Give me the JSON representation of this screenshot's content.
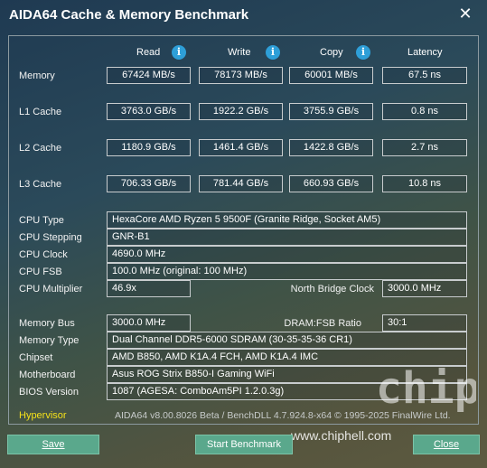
{
  "window": {
    "title": "AIDA64 Cache & Memory Benchmark",
    "close_glyph": "✕"
  },
  "columns": {
    "read": "Read",
    "write": "Write",
    "copy": "Copy",
    "latency": "Latency",
    "info_glyph": "i"
  },
  "bench": [
    {
      "label": "Memory",
      "read": "67424 MB/s",
      "write": "78173 MB/s",
      "copy": "60001 MB/s",
      "latency": "67.5 ns"
    },
    {
      "label": "L1 Cache",
      "read": "3763.0 GB/s",
      "write": "1922.2 GB/s",
      "copy": "3755.9 GB/s",
      "latency": "0.8 ns"
    },
    {
      "label": "L2 Cache",
      "read": "1180.9 GB/s",
      "write": "1461.4 GB/s",
      "copy": "1422.8 GB/s",
      "latency": "2.7 ns"
    },
    {
      "label": "L3 Cache",
      "read": "706.33 GB/s",
      "write": "781.44 GB/s",
      "copy": "660.93 GB/s",
      "latency": "10.8 ns"
    }
  ],
  "info": {
    "cpu_type": {
      "label": "CPU Type",
      "value": "HexaCore AMD Ryzen 5 9500F  (Granite Ridge, Socket AM5)"
    },
    "cpu_stepping": {
      "label": "CPU Stepping",
      "value": "GNR-B1"
    },
    "cpu_clock": {
      "label": "CPU Clock",
      "value": "4690.0 MHz"
    },
    "cpu_fsb": {
      "label": "CPU FSB",
      "value": "100.0 MHz  (original: 100 MHz)"
    },
    "cpu_multiplier": {
      "label": "CPU Multiplier",
      "value": "46.9x"
    },
    "north_bridge_clock": {
      "label": "North Bridge Clock",
      "value": "3000.0 MHz"
    },
    "memory_bus": {
      "label": "Memory Bus",
      "value": "3000.0 MHz"
    },
    "dram_fsb_ratio": {
      "label": "DRAM:FSB Ratio",
      "value": "30:1"
    },
    "memory_type": {
      "label": "Memory Type",
      "value": "Dual Channel DDR5-6000 SDRAM  (30-35-35-36 CR1)"
    },
    "chipset": {
      "label": "Chipset",
      "value": "AMD B850, AMD K1A.4 FCH, AMD K1A.4 IMC"
    },
    "motherboard": {
      "label": "Motherboard",
      "value": "Asus ROG Strix B850-I Gaming WiFi"
    },
    "bios_version": {
      "label": "BIOS Version",
      "value": "1087  (AGESA: ComboAm5PI 1.2.0.3g)"
    }
  },
  "footer": {
    "hypervisor": "Hypervisor",
    "version_text": "AIDA64 v8.00.8026 Beta / BenchDLL 4.7.924.8-x64  © 1995-2025 FinalWire Ltd."
  },
  "buttons": {
    "save": "Save",
    "start_benchmark": "Start Benchmark",
    "close": "Close"
  },
  "watermark": {
    "url": "www.chiphell.com",
    "logo_text": "chip hell"
  },
  "colors": {
    "accent_info": "#2e9fd8",
    "button": "#5aa88c",
    "hypervisor": "#f4e11a"
  }
}
